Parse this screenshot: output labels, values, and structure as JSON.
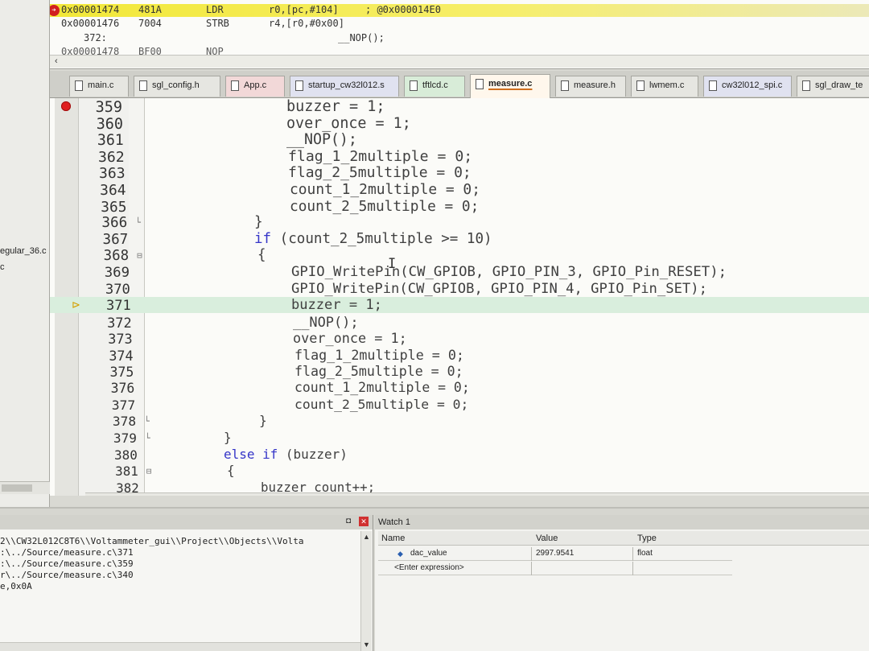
{
  "disassembly": {
    "lines": [
      {
        "addr": "0x00001474",
        "opcode": "481A",
        "mnemonic": "LDR",
        "operands": "r0,[pc,#104]",
        "comment": "; @0x000014E0"
      },
      {
        "addr": "0x00001476",
        "opcode": "7004",
        "mnemonic": "STRB",
        "operands": "r4,[r0,#0x00]",
        "comment": ""
      },
      {
        "addr": "372:",
        "opcode": "",
        "mnemonic": "",
        "operands": "__NOP();",
        "comment": ""
      },
      {
        "addr": "0x00001478",
        "opcode": "BF00",
        "mnemonic": "NOP",
        "operands": "",
        "comment": ""
      }
    ]
  },
  "left_panel": {
    "items": [
      "egular_36.c",
      "c"
    ]
  },
  "tabs": [
    {
      "label": "main.c",
      "color": "#e6e6e1"
    },
    {
      "label": "sgl_config.h",
      "color": "#e6e6e1"
    },
    {
      "label": "App.c",
      "color": "#f2d8d8"
    },
    {
      "label": "startup_cw32l012.s",
      "color": "#e0e2f0"
    },
    {
      "label": "tftlcd.c",
      "color": "#d8ecd8"
    },
    {
      "label": "measure.c",
      "color": "#fff7ec"
    },
    {
      "label": "measure.h",
      "color": "#e6e6e1"
    },
    {
      "label": "lwmem.c",
      "color": "#e6e6e1"
    },
    {
      "label": "cw32l012_spi.c",
      "color": "#e0e2f0"
    },
    {
      "label": "sgl_draw_te",
      "color": "#e6e6e1"
    }
  ],
  "editor": {
    "lines": [
      {
        "num": "359",
        "code": "buzzer = 1;"
      },
      {
        "num": "360",
        "code": "over_once = 1;"
      },
      {
        "num": "361",
        "code": "__NOP();"
      },
      {
        "num": "362",
        "code": "flag_1_2multiple = 0;"
      },
      {
        "num": "363",
        "code": "flag_2_5multiple = 0;"
      },
      {
        "num": "364",
        "code": "count_1_2multiple = 0;"
      },
      {
        "num": "365",
        "code": "count_2_5multiple = 0;"
      },
      {
        "num": "366",
        "code": "}"
      },
      {
        "num": "367",
        "kw": "if",
        "code": " (count_2_5multiple >= 10)"
      },
      {
        "num": "368",
        "code": "{"
      },
      {
        "num": "369",
        "code": "GPIO_WritePin(CW_GPIOB, GPIO_PIN_3, GPIO_Pin_RESET);"
      },
      {
        "num": "370",
        "code": "GPIO_WritePin(CW_GPIOB, GPIO_PIN_4, GPIO_Pin_SET);"
      },
      {
        "num": "371",
        "code": "buzzer = 1;"
      },
      {
        "num": "372",
        "code": "__NOP();"
      },
      {
        "num": "373",
        "code": "over_once = 1;"
      },
      {
        "num": "374",
        "code": "flag_1_2multiple = 0;"
      },
      {
        "num": "375",
        "code": "flag_2_5multiple = 0;"
      },
      {
        "num": "376",
        "code": "count_1_2multiple = 0;"
      },
      {
        "num": "377",
        "code": "count_2_5multiple = 0;"
      },
      {
        "num": "378",
        "code": "}"
      },
      {
        "num": "379",
        "code": "}"
      },
      {
        "num": "380",
        "kw": "else if",
        "code": " (buzzer)"
      },
      {
        "num": "381",
        "code": "{"
      },
      {
        "num": "382",
        "code": "buzzer_count++;"
      }
    ]
  },
  "command": {
    "lines": [
      "2\\\\CW32L012C8T6\\\\Voltammeter_gui\\\\Project\\\\Objects\\\\Volta",
      ":\\../Source/measure.c\\371",
      ":\\../Source/measure.c\\359",
      "r\\../Source/measure.c\\340",
      "e,0x0A"
    ]
  },
  "watch": {
    "title": "Watch 1",
    "columns": {
      "name": "Name",
      "value": "Value",
      "type": "Type"
    },
    "rows": [
      {
        "name": "dac_value",
        "value": "2997.9541",
        "type": "float"
      },
      {
        "name": "<Enter expression>",
        "value": "",
        "type": ""
      }
    ]
  }
}
